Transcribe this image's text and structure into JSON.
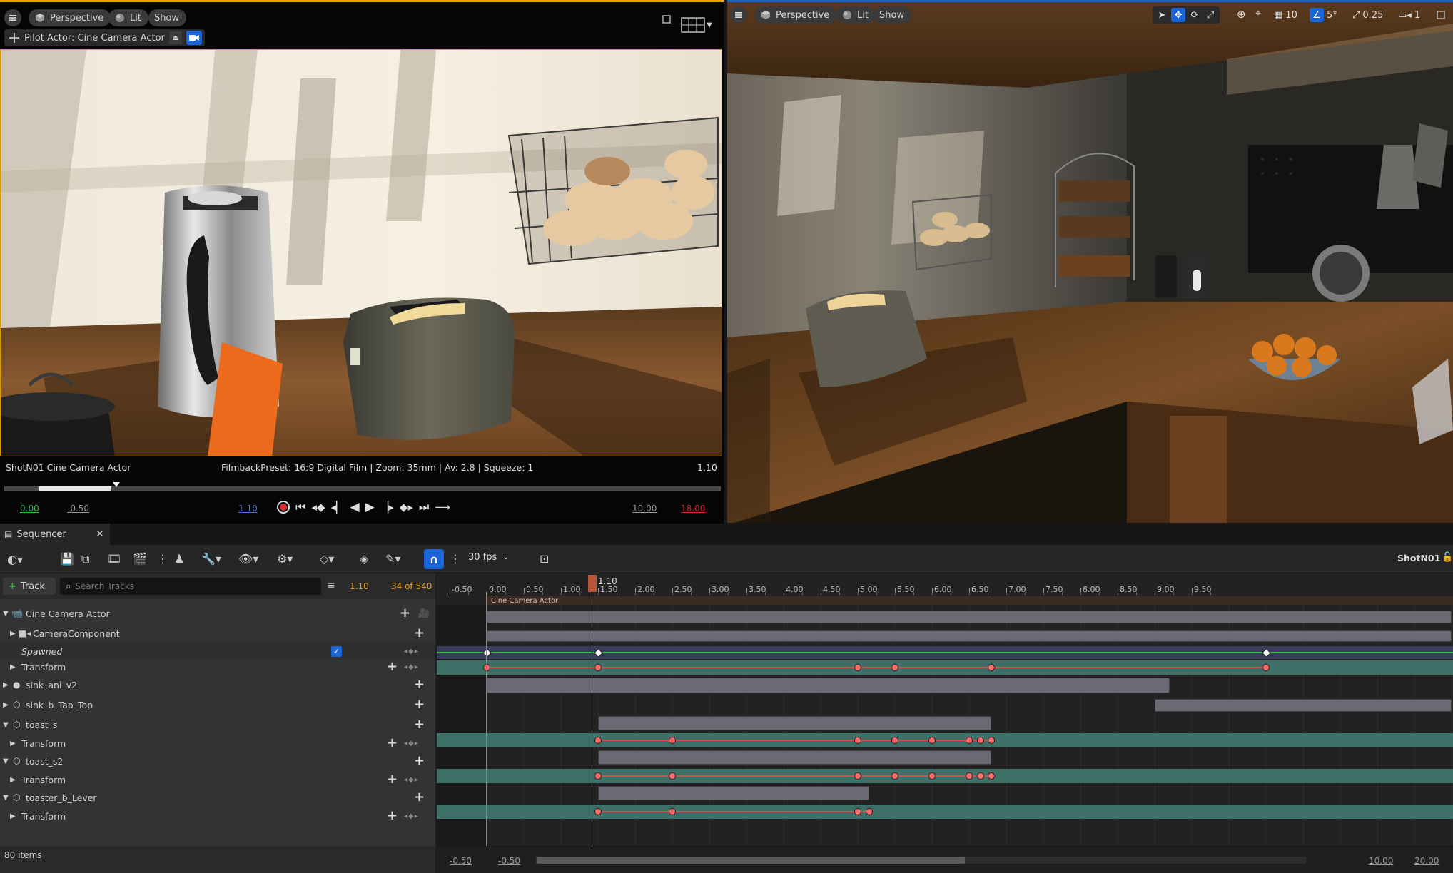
{
  "left_viewport": {
    "view_mode": "Perspective",
    "lit": "Lit",
    "show": "Show",
    "pilot_label": "Pilot Actor: Cine Camera Actor",
    "camera_name": "ShotN01 Cine Camera Actor",
    "filmback": "FilmbackPreset: 16:9 Digital Film | Zoom: 35mm | Av: 2.8 | Squeeze: 1",
    "frame_readout": "1.10",
    "scrub_progress": 0.155,
    "start_time": "0.00",
    "start_offset": "-0.50",
    "current_time": "1.10",
    "end_time": "10.00",
    "end_red": "18.00"
  },
  "right_viewport": {
    "view_mode": "Perspective",
    "lit": "Lit",
    "show": "Show",
    "grid_size": "10",
    "rotation_snap": "5°",
    "scale_snap": "0.25",
    "camera_speed": "1"
  },
  "sequencer": {
    "tab_label": "Sequencer",
    "fps": "30 fps",
    "sequence_name": "ShotN01",
    "add_track_label": "Track",
    "search_placeholder": "Search Tracks",
    "current_time": "1.10",
    "frame_count": "34 of 540",
    "playhead_label": "1.10",
    "items_count": "80 items",
    "bottom_left_a": "-0.50",
    "bottom_left_b": "-0.50",
    "bottom_right_a": "10.00",
    "bottom_right_b": "20.00",
    "camera_cut_label": "Cine Camera Actor",
    "ruler_ticks": [
      "-0.50",
      "0.00",
      "0.50",
      "1.00",
      "1.50",
      "2.00",
      "2.50",
      "3.00",
      "3.50",
      "4.00",
      "4.50",
      "5.00",
      "5.50",
      "6.00",
      "6.50",
      "7.00",
      "7.50",
      "8.00",
      "8.50",
      "9.00",
      "9.50"
    ],
    "tracks": [
      {
        "label": "Cine Camera Actor"
      },
      {
        "label": "CameraComponent"
      },
      {
        "label": "Spawned"
      },
      {
        "label": "Transform"
      },
      {
        "label": "sink_ani_v2"
      },
      {
        "label": "sink_b_Tap_Top"
      },
      {
        "label": "toast_s"
      },
      {
        "label": "Transform"
      },
      {
        "label": "toast_s2"
      },
      {
        "label": "Transform"
      },
      {
        "label": "toaster_b_Lever"
      },
      {
        "label": "Transform"
      }
    ]
  },
  "colors": {
    "accent_blue": "#1a64d8",
    "keyframe": "#ff6a6a",
    "transform_row": "#3e7068",
    "viewport_border_orange": "#e6a400",
    "record_red": "#e03030"
  }
}
